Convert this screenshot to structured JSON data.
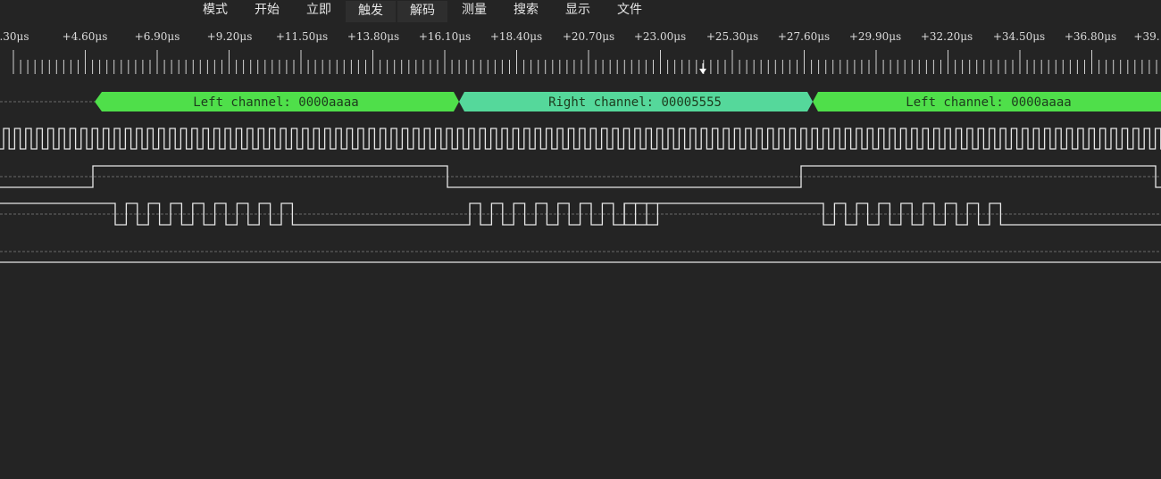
{
  "menu": {
    "items": [
      {
        "label": "模式",
        "active": false
      },
      {
        "label": "开始",
        "active": false
      },
      {
        "label": "立即",
        "active": false
      },
      {
        "label": "触发",
        "active": true
      },
      {
        "label": "解码",
        "active": true
      },
      {
        "label": "测量",
        "active": false
      },
      {
        "label": "搜索",
        "active": false
      },
      {
        "label": "显示",
        "active": false
      },
      {
        "label": "文件",
        "active": false
      }
    ]
  },
  "ruler": {
    "labels": [
      ".30μs",
      "+4.60μs",
      "+6.90μs",
      "+9.20μs",
      "+11.50μs",
      "+13.80μs",
      "+16.10μs",
      "+18.40μs",
      "+20.70μs",
      "+23.00μs",
      "+25.30μs",
      "+27.60μs",
      "+29.90μs",
      "+32.20μs",
      "+34.50μs",
      "+36.80μs",
      "+39."
    ]
  },
  "decode": {
    "segments": [
      {
        "label": "Left channel: 0000aaaa",
        "kind": "left"
      },
      {
        "label": "Right channel: 00005555",
        "kind": "right"
      },
      {
        "label": "Left channel: 0000aaaa",
        "kind": "left"
      }
    ]
  },
  "colors": {
    "background": "#242424",
    "left_channel": "#4fdf4a",
    "right_channel": "#55d89b",
    "wave": "#e8e8e8",
    "grid": "#6a6a6a"
  }
}
